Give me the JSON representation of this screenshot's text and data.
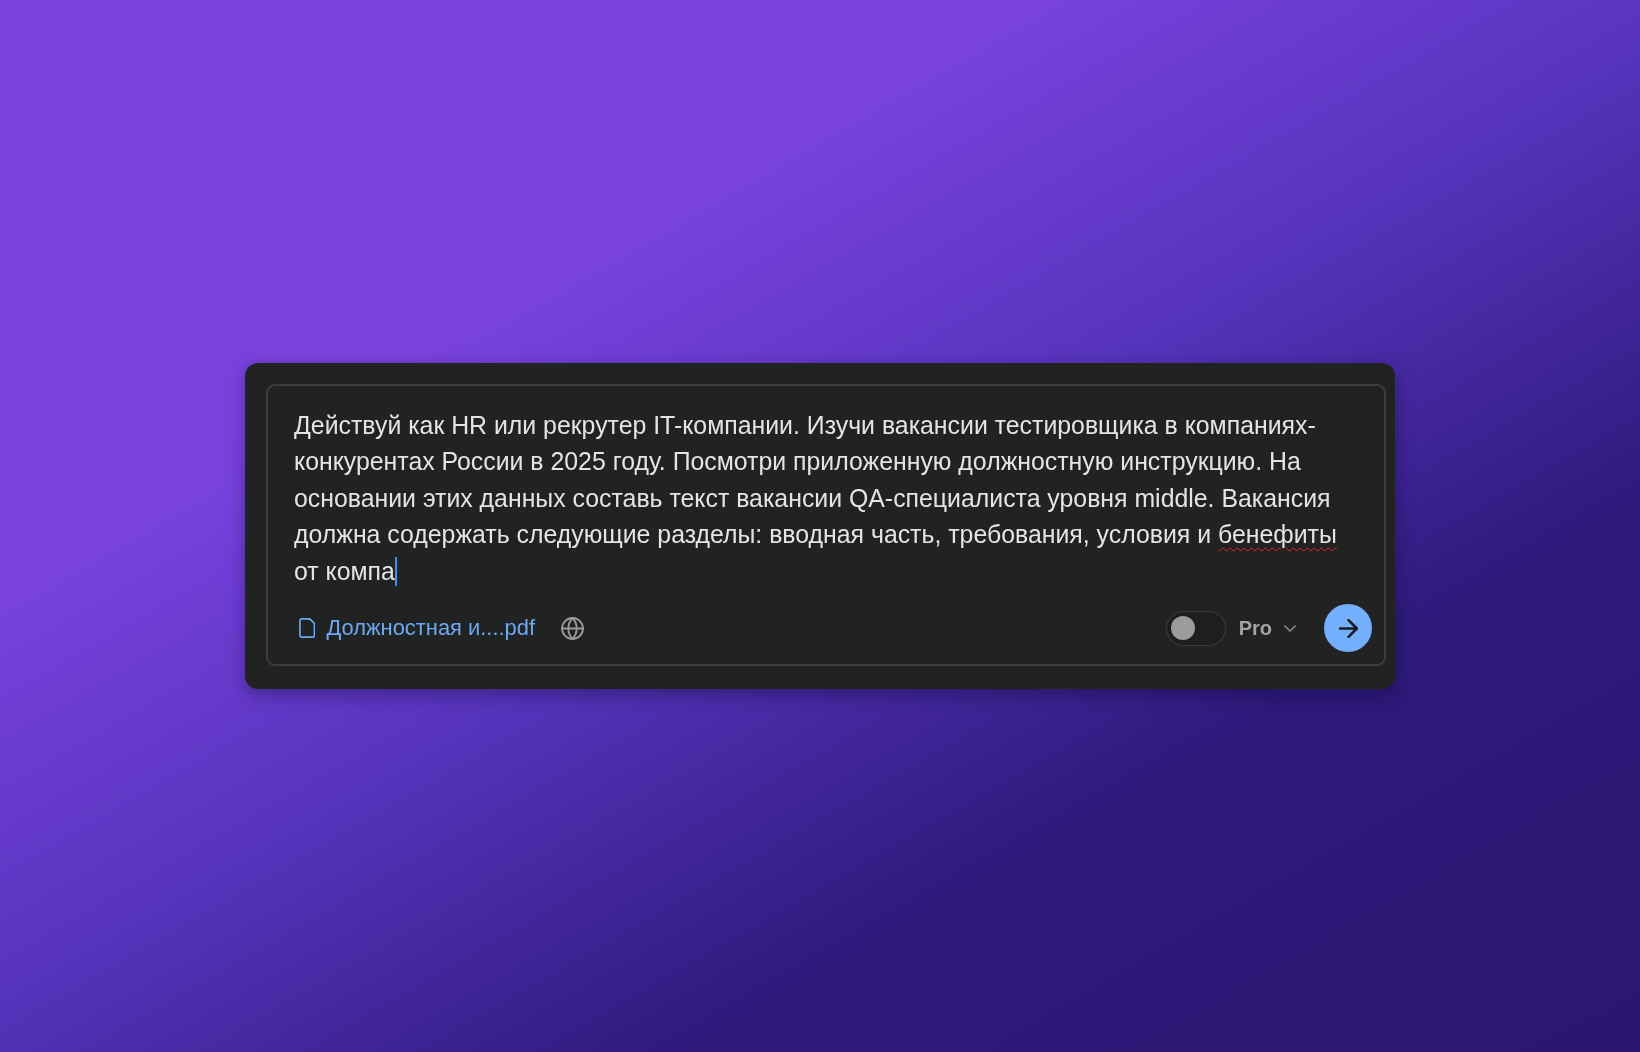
{
  "prompt": {
    "focused": true,
    "segments": [
      {
        "text": "Действуй как HR или рекрутер IT-компании. Изучи вакансии тестировщика в компаниях-конкурентах России в 2025 году. Посмотри приложенную должностную инструкцию. На основании этих данных составь текст вакансии QA-специалиста уровня middle. Вакансия должна содержать следующие разделы: вводная часть, требования, условия и ",
        "misspelled": false
      },
      {
        "text": "бенефиты",
        "misspelled": true
      },
      {
        "text": " от компа",
        "misspelled": false
      }
    ]
  },
  "attachment": {
    "file_name": "Должностная и....pdf"
  },
  "toggle": {
    "on": false
  },
  "model_selector": {
    "label": "Pro"
  }
}
